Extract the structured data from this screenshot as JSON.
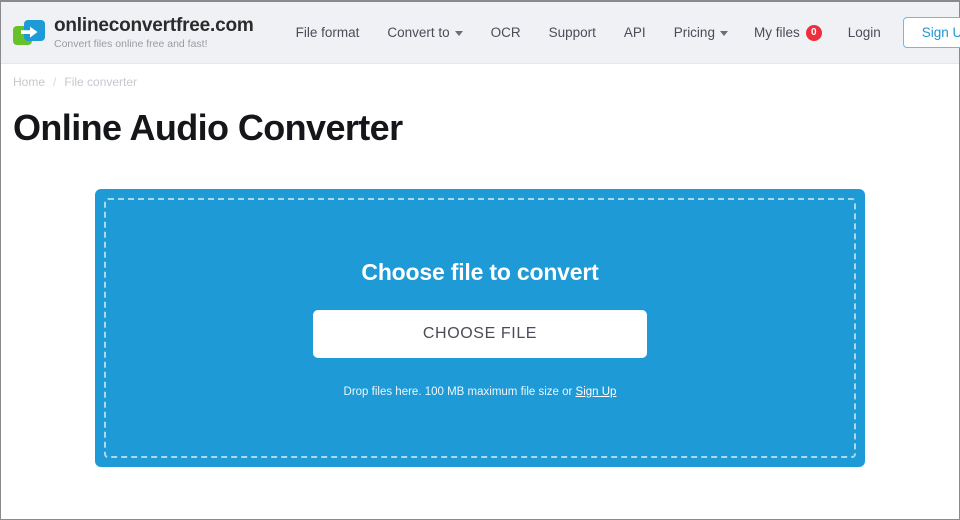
{
  "header": {
    "brand": {
      "name": "onlineconvertfree.com",
      "tagline": "Convert files online free and fast!",
      "logo_icon": "convert-arrow-logo",
      "colors": {
        "green": "#67c12a",
        "blue": "#1e9ad6"
      }
    },
    "nav": [
      {
        "label": "File format",
        "has_chevron": false
      },
      {
        "label": "Convert to",
        "has_chevron": true
      },
      {
        "label": "OCR",
        "has_chevron": false
      },
      {
        "label": "Support",
        "has_chevron": false
      },
      {
        "label": "API",
        "has_chevron": false
      },
      {
        "label": "Pricing",
        "has_chevron": true
      }
    ],
    "my_files": {
      "label": "My files",
      "count": "0",
      "badge_color": "#ed2e3d"
    },
    "login_label": "Login",
    "signup_label": "Sign Up",
    "background": "#f0f1f5"
  },
  "breadcrumb": {
    "items": [
      "Home",
      "File converter"
    ],
    "separator": "/"
  },
  "main": {
    "page_title": "Online Audio Converter",
    "dropzone": {
      "heading": "Choose file to convert",
      "button_label": "CHOOSE FILE",
      "hint_prefix": "Drop files here. 100 MB maximum file size or ",
      "hint_link": "Sign Up",
      "max_file_size": "100 MB",
      "accent_color": "#1e9ad6"
    }
  }
}
